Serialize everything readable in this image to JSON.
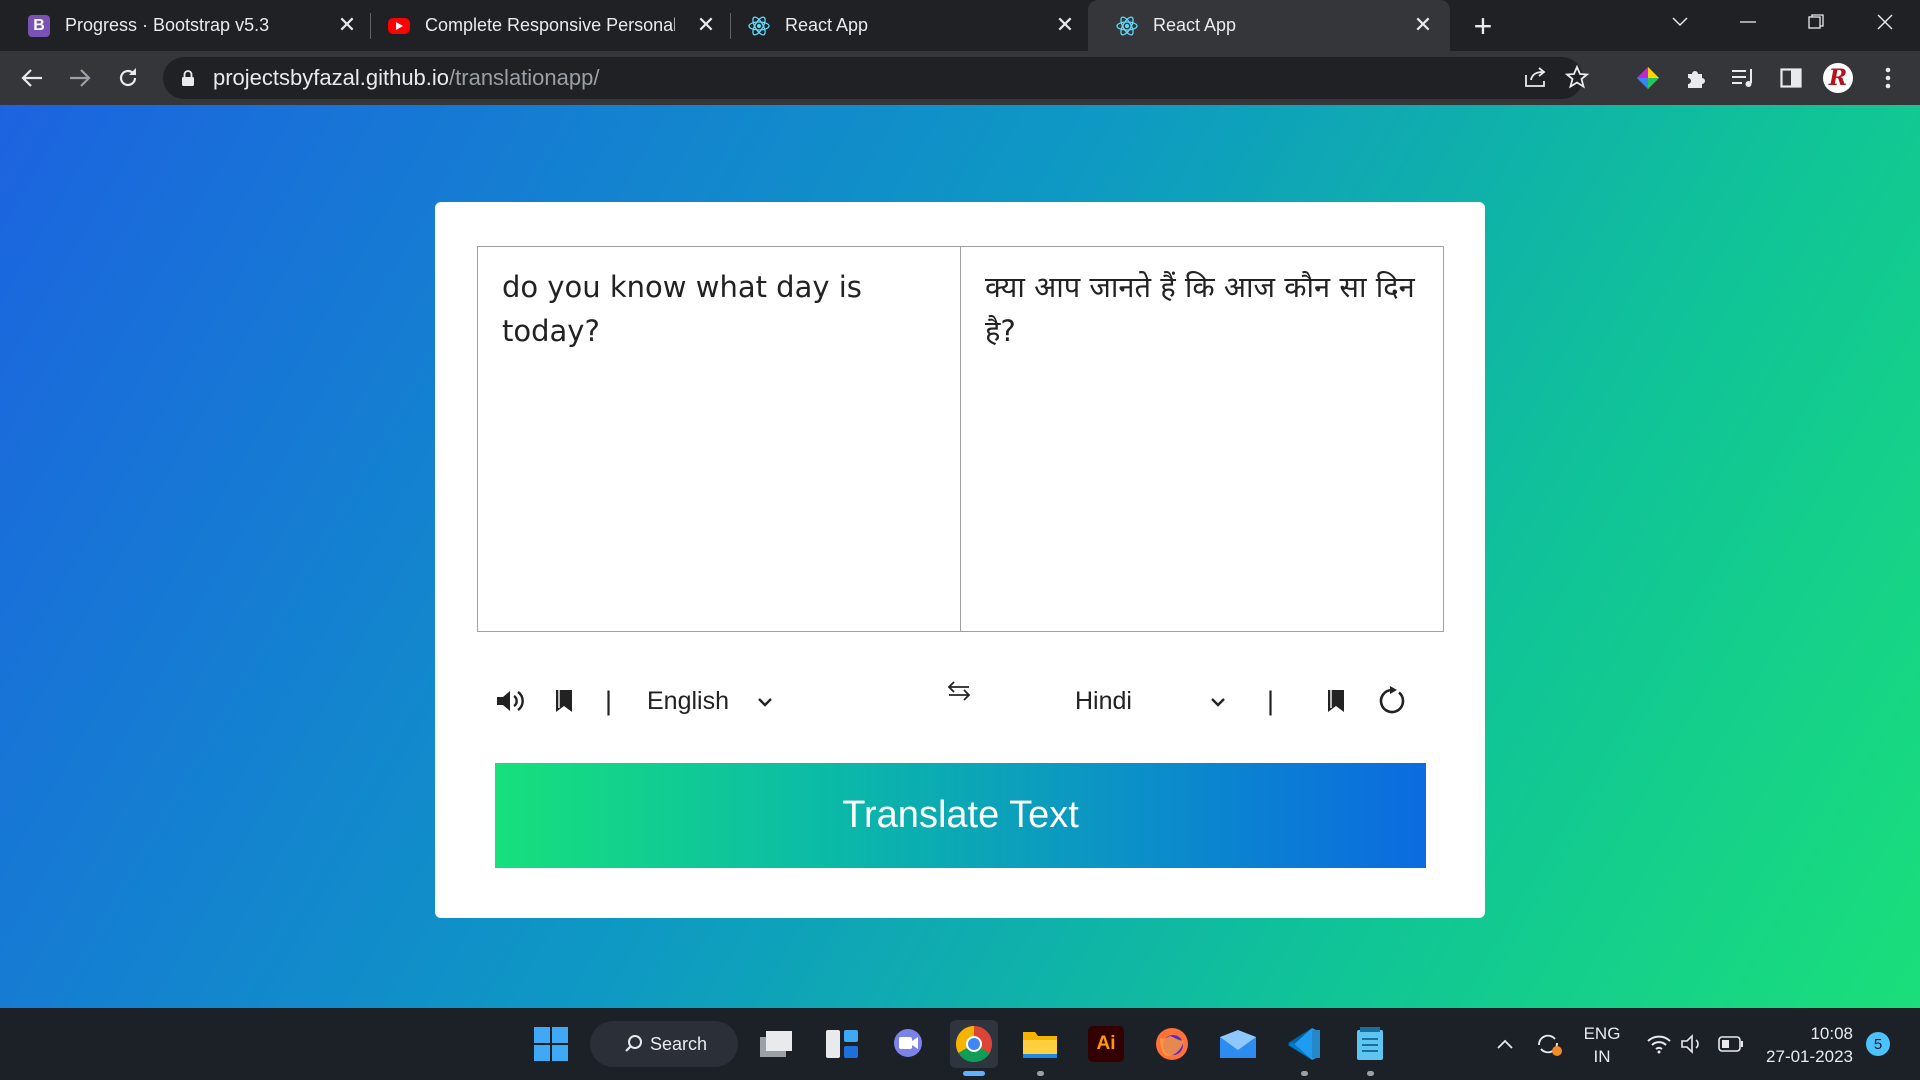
{
  "browser": {
    "tabs": [
      {
        "title": "Progress · Bootstrap v5.3",
        "favicon": "bootstrap-icon"
      },
      {
        "title": "Complete Responsive Personal Po",
        "favicon": "youtube-icon"
      },
      {
        "title": "React App",
        "favicon": "react-icon"
      },
      {
        "title": "React App",
        "favicon": "react-icon"
      }
    ],
    "active_tab_index": 3,
    "url_host": "projectsbyfazal.github.io",
    "url_path": "/translationapp/",
    "profile_initial": "R"
  },
  "translator": {
    "from_text": "do you know what day is today?",
    "to_text": "क्या आप जानते हैं कि आज कौन सा दिन है?",
    "from_language": "English",
    "to_language": "Hindi",
    "separator": "|",
    "translate_label": "Translate Text"
  },
  "taskbar": {
    "search_label": "Search",
    "language_line1": "ENG",
    "language_line2": "IN",
    "time": "10:08",
    "date": "27-01-2023",
    "notification_count": "5"
  },
  "colors": {
    "gradient_start": "#1c63e0",
    "gradient_end": "#1adf7a",
    "button_start": "#17e07c",
    "button_end": "#0b6be0"
  }
}
